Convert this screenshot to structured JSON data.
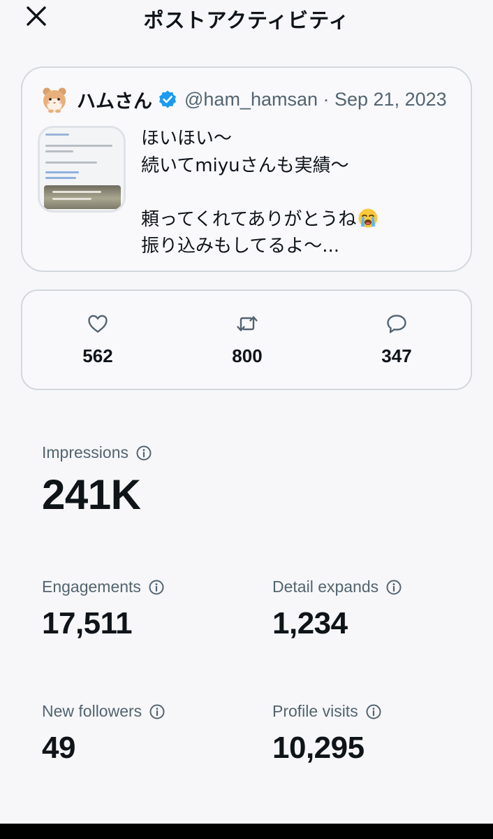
{
  "header": {
    "title": "ポストアクティビティ"
  },
  "post": {
    "display_name": "ハムさん",
    "handle_date": "@ham_hamsan · Sep 21, 2023",
    "lines": [
      "ほいほい〜",
      "続いてmiyuさんも実績〜",
      "",
      "頼ってくれてありがとうね",
      "振り込みもしてるよ〜..."
    ]
  },
  "reactions": {
    "likes": "562",
    "reposts": "800",
    "replies": "347"
  },
  "metrics": {
    "impressions": {
      "label": "Impressions",
      "value": "241K"
    },
    "engagements": {
      "label": "Engagements",
      "value": "17,511"
    },
    "detail_expands": {
      "label": "Detail expands",
      "value": "1,234"
    },
    "new_followers": {
      "label": "New followers",
      "value": "49"
    },
    "profile_visits": {
      "label": "Profile visits",
      "value": "10,295"
    }
  },
  "colors": {
    "verified": "#1d9bf0",
    "text_primary": "#0f1419",
    "text_secondary": "#536471",
    "border": "#d3d8dd"
  },
  "icons": [
    "close-icon",
    "verified-badge-icon",
    "heart-icon",
    "repost-icon",
    "reply-icon",
    "info-icon",
    "crying-face-emoji"
  ]
}
